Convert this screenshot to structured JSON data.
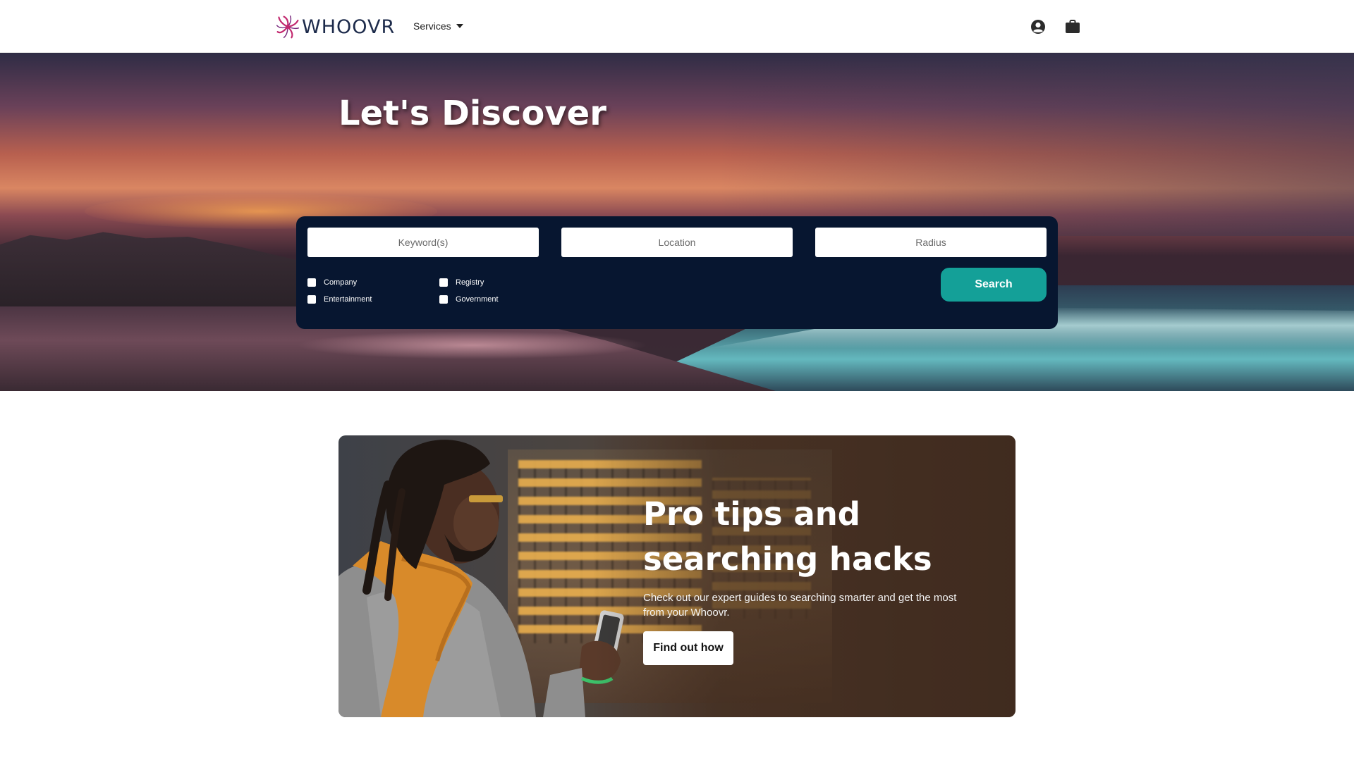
{
  "navbar": {
    "brand": "WHOOVR",
    "services_label": "Services",
    "icons": [
      "user-circle-icon",
      "briefcase-icon"
    ]
  },
  "hero": {
    "title": "Let's Discover",
    "search": {
      "keyword_placeholder": "Keyword(s)",
      "location_placeholder": "Location",
      "radius_placeholder": "Radius",
      "filters": [
        "Company",
        "Registry",
        "Entertainment",
        "Government"
      ],
      "button_label": "Search"
    }
  },
  "promo": {
    "title": "Pro tips and searching hacks",
    "text": "Check out our expert guides to searching smarter and get the most from your Whoovr.",
    "button_label": "Find out how"
  },
  "colors": {
    "brand_navy": "#1c2a4a",
    "logo_magenta": "#c2286e",
    "search_panel": "#071630",
    "search_button": "#14a098"
  }
}
